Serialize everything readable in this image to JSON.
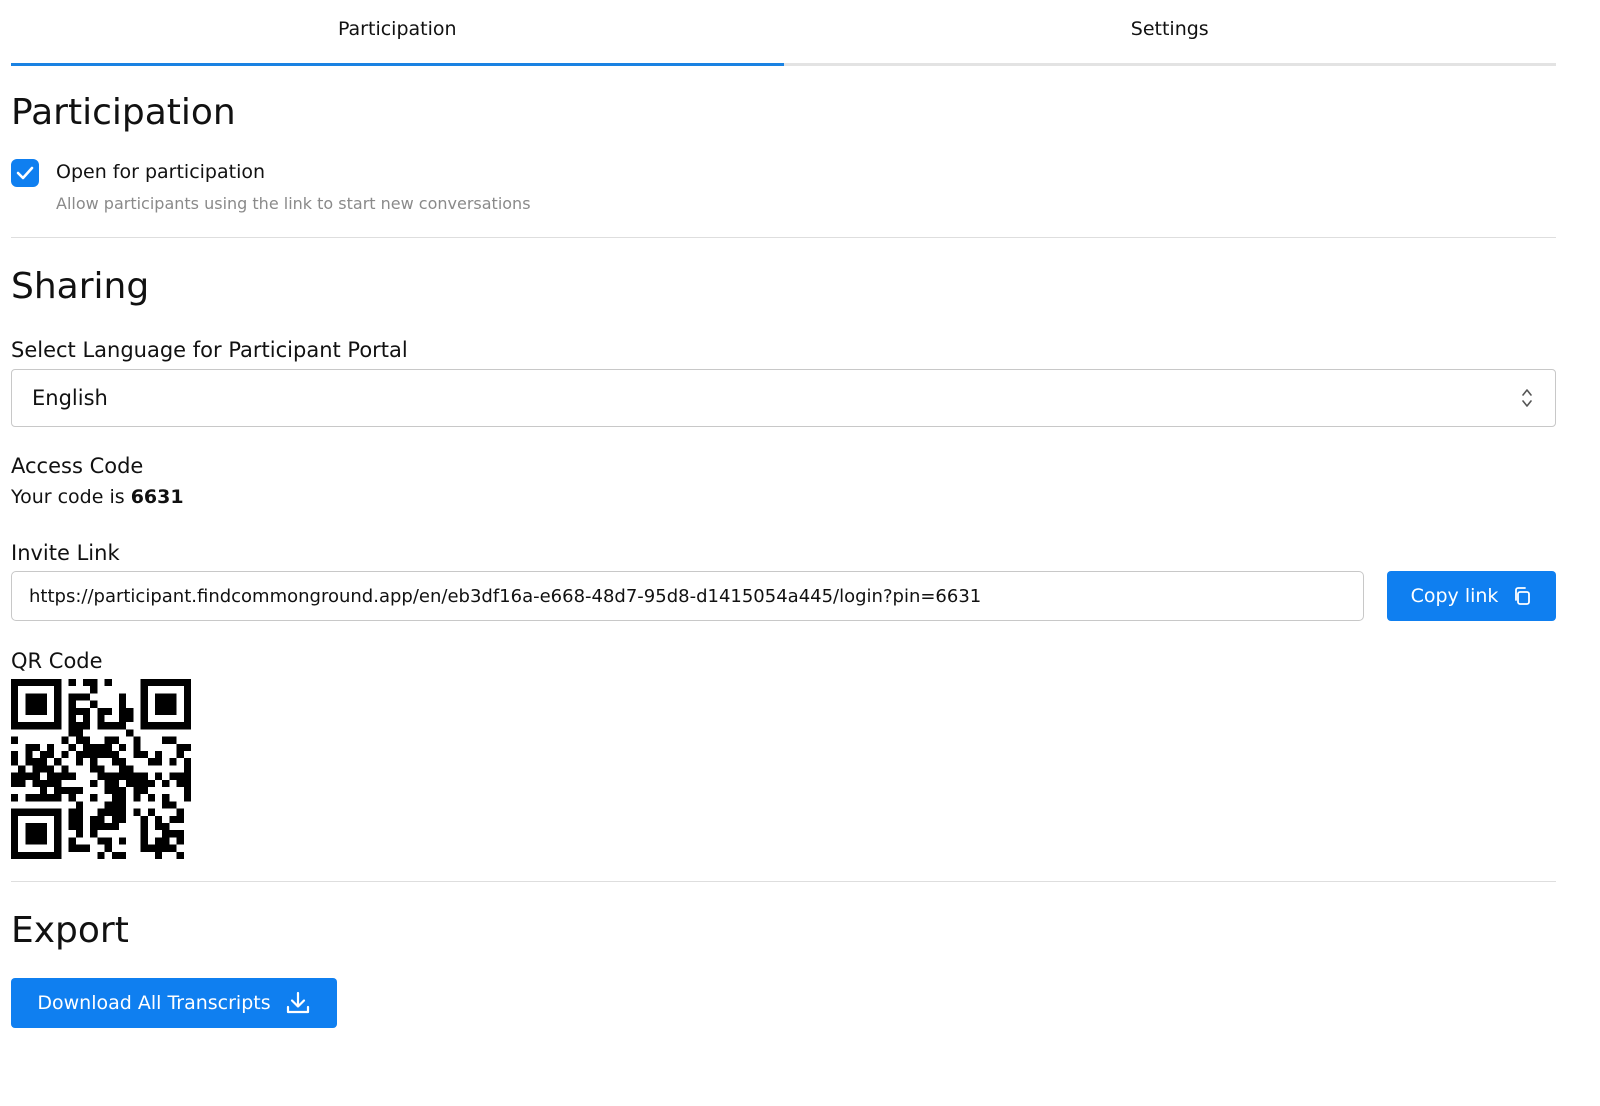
{
  "tabs": [
    {
      "label": "Participation",
      "active": true
    },
    {
      "label": "Settings",
      "active": false
    }
  ],
  "participation": {
    "heading": "Participation",
    "checkbox_label": "Open for participation",
    "checkbox_checked": true,
    "checkbox_description": "Allow participants using the link to start new conversations"
  },
  "sharing": {
    "heading": "Sharing",
    "language_label": "Select Language for Participant Portal",
    "language_value": "English",
    "access_code_label": "Access Code",
    "code_prefix": "Your code is",
    "code": "6631",
    "invite_label": "Invite Link",
    "invite_url": "https://participant.findcommonground.app/en/eb3df16a-e668-48d7-95d8-d1415054a445/login?pin=6631",
    "copy_label": "Copy link",
    "qr_label": "QR Code"
  },
  "export": {
    "heading": "Export",
    "download_label": "Download All Transcripts"
  },
  "colors": {
    "accent": "#0f7ff0",
    "tab_indicator": "#1a82e2",
    "muted_text": "#8a8a8a",
    "border": "#c8c8c8"
  },
  "icons": {
    "checkbox": "check-icon",
    "select": "chevron-up-down-icon",
    "copy": "copy-icon",
    "download": "download-icon"
  }
}
